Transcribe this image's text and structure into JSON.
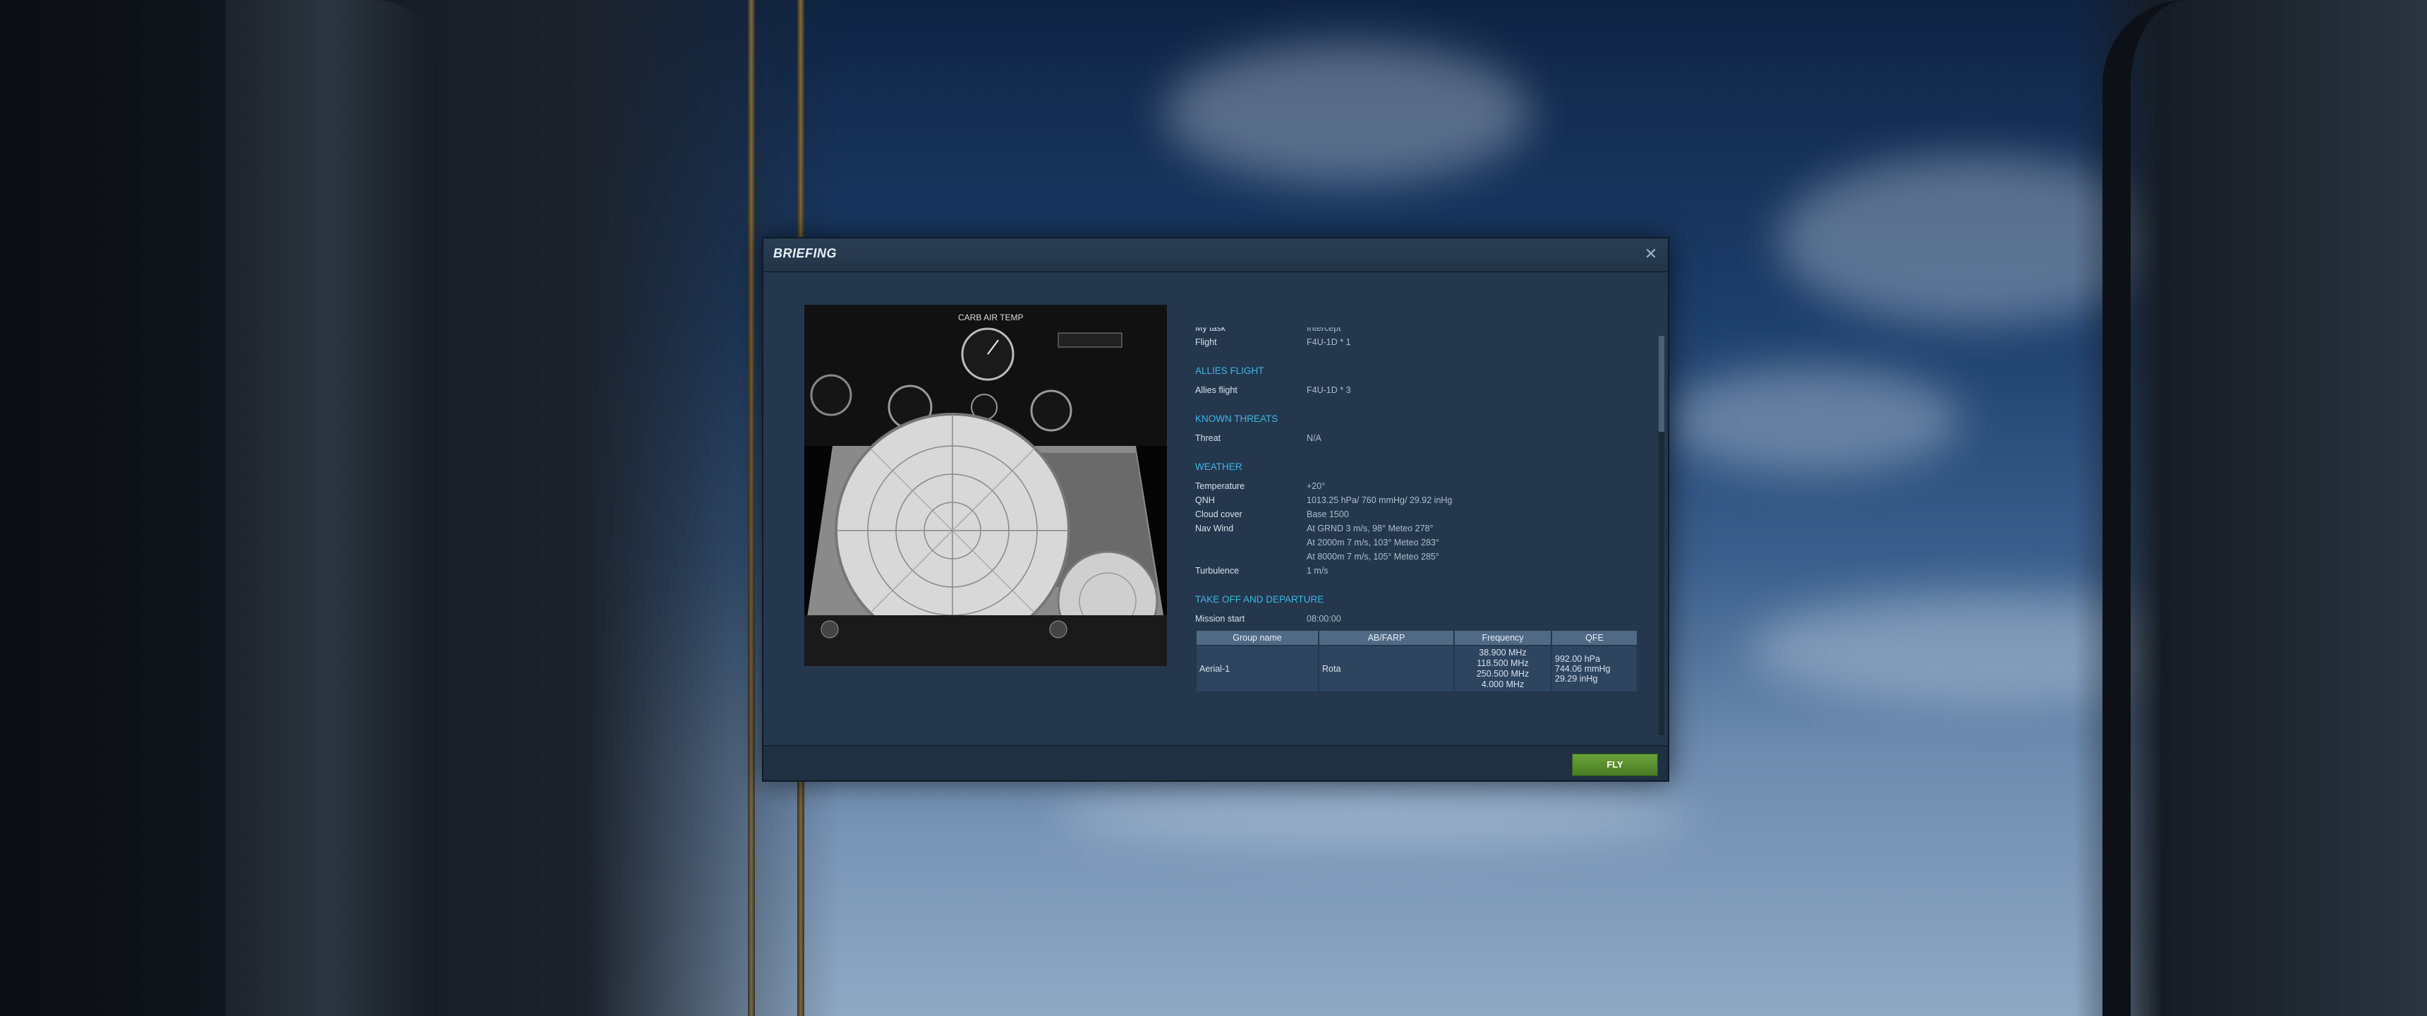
{
  "dialog": {
    "title": "BRIEFING",
    "close_icon": "close-icon",
    "fly_label": "FLY"
  },
  "image": {
    "caption": "CARB AIR TEMP"
  },
  "task": {
    "my_task_label": "My task",
    "my_task_value": "Intercept",
    "flight_label": "Flight",
    "flight_value": "F4U-1D * 1"
  },
  "allies": {
    "heading": "ALLIES FLIGHT",
    "label": "Allies flight",
    "value": "F4U-1D * 3"
  },
  "threats": {
    "heading": "KNOWN THREATS",
    "label": "Threat",
    "value": "N/A"
  },
  "weather": {
    "heading": "WEATHER",
    "temperature_label": "Temperature",
    "temperature_value": "+20°",
    "qnh_label": "QNH",
    "qnh_value": "1013.25 hPa/ 760 mmHg/ 29.92 inHg",
    "cloud_label": "Cloud cover",
    "cloud_value": "Base 1500",
    "wind_label": "Nav Wind",
    "wind_lines": [
      "At GRND 3 m/s, 98° Meteo 278°",
      "At 2000m 7 m/s, 103° Meteo 283°",
      "At 8000m 7 m/s, 105° Meteo 285°"
    ],
    "turbulence_label": "Turbulence",
    "turbulence_value": "1 m/s"
  },
  "departure": {
    "heading": "TAKE OFF AND DEPARTURE",
    "mission_start_label": "Mission start",
    "mission_start_value": "08:00:00",
    "columns": [
      "Group name",
      "AB/FARP",
      "Frequency",
      "QFE"
    ],
    "row": {
      "group": "Aerial-1",
      "airbase": "Rota",
      "frequencies": [
        "38.900 MHz",
        "118.500 MHz",
        "250.500 MHz",
        "4.000 MHz"
      ],
      "qfe": [
        "992.00 hPa",
        "744.06 mmHg",
        "29.29 inHg"
      ]
    }
  },
  "colors": {
    "section_heading": "#3fb6e8",
    "fly_button": "#5a8f2e",
    "dialog_bg": "#24374c"
  }
}
